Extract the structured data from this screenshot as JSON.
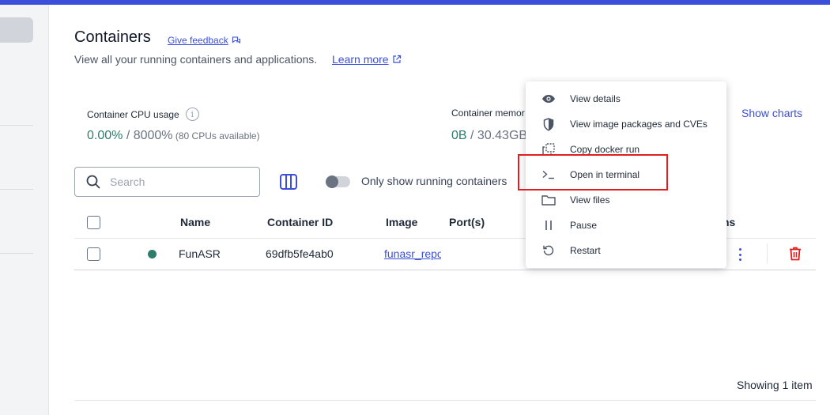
{
  "page": {
    "title": "Containers",
    "feedback_label": "Give feedback",
    "subtitle": "View all your running containers and applications.",
    "learn_more_label": "Learn more"
  },
  "stats": {
    "cpu_label": "Container CPU usage",
    "cpu_value": "0.00%",
    "cpu_total": " / 8000%",
    "cpu_note": " (80 CPUs available)",
    "memory_label": "Container memor",
    "memory_value": "0B",
    "memory_total": " / 30.43GB",
    "show_charts_label": "Show charts"
  },
  "toolbar": {
    "search_placeholder": "Search",
    "toggle_label": "Only show running containers",
    "toggle_on": false
  },
  "table": {
    "columns": [
      "Name",
      "Container ID",
      "Image",
      "Port(s)",
      "ns"
    ],
    "rows": [
      {
        "name": "FunASR",
        "container_id": "69dfb5fe4ab0",
        "image": "funasr_repo",
        "status": "running"
      }
    ]
  },
  "context_menu": {
    "items": [
      {
        "label": "View details",
        "icon": "eye-icon"
      },
      {
        "label": "View image packages and CVEs",
        "icon": "shield-icon"
      },
      {
        "label": "Copy docker run",
        "icon": "copy-icon"
      },
      {
        "label": "Open in terminal",
        "icon": "terminal-icon",
        "highlighted": true
      },
      {
        "label": "View files",
        "icon": "folder-icon"
      },
      {
        "label": "Pause",
        "icon": "pause-icon"
      },
      {
        "label": "Restart",
        "icon": "restart-icon"
      }
    ]
  },
  "footer": {
    "showing": "Showing 1 item"
  },
  "colors": {
    "accent": "#3b4fdb",
    "running": "#2e7d6b",
    "danger": "#e02020"
  }
}
